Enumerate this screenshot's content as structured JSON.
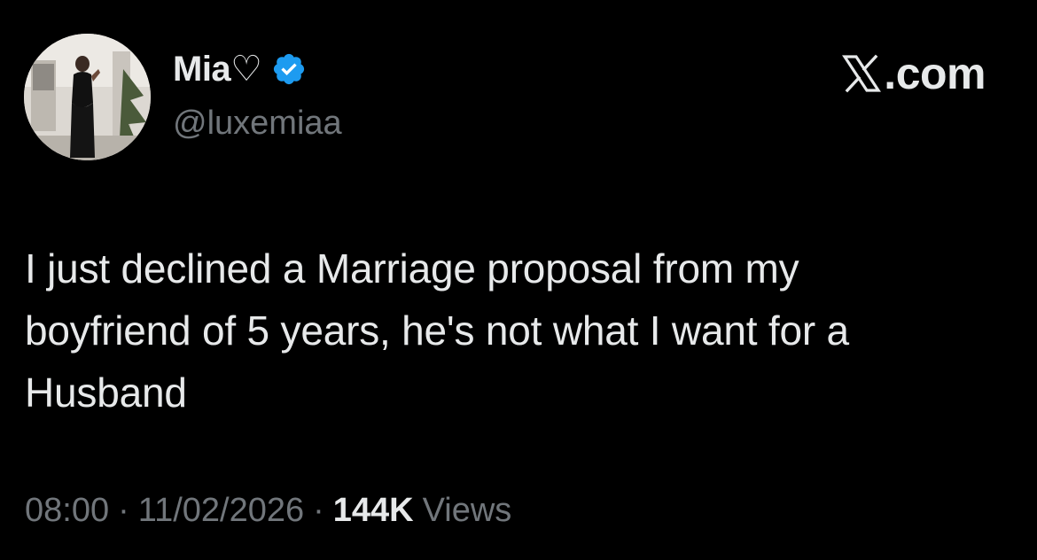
{
  "author": {
    "name": "Mia♡",
    "handle": "@luxemiaa",
    "verified": true
  },
  "site": {
    "label": ".com",
    "logo_icon": "x-logo-icon"
  },
  "tweet": {
    "text": "I just declined a Marriage proposal from my\nboyfriend of 5 years, he's not what I want for a\nHusband"
  },
  "meta": {
    "time": "08:00",
    "separator": "·",
    "date": "11/02/2026",
    "views_count": "144K",
    "views_label": "Views"
  },
  "colors": {
    "background": "#000000",
    "primary_text": "#e7e9ea",
    "secondary_text": "#71767b",
    "verified_badge": "#1d9bf0"
  }
}
